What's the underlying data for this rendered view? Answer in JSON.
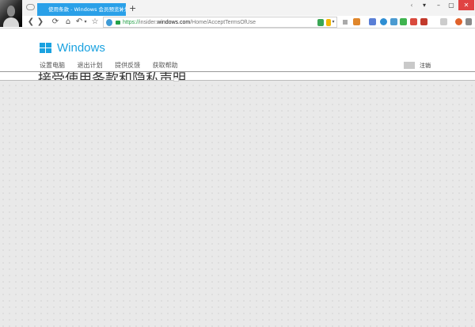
{
  "browser": {
    "tab_title": "使用条款 - Windows 会员预览计划",
    "tab_close": "×",
    "new_tab": "+",
    "window_controls": [
      "‹",
      "▾",
      "–",
      "▢",
      "✕"
    ],
    "nav": {
      "back": "❮",
      "forward": "❯",
      "reload": "⟳",
      "home": "⌂",
      "undo": "↶",
      "undo_menu": "▾",
      "favorite": "☆"
    },
    "url": {
      "scheme": "https://",
      "host_pre": "insider.",
      "host": "windows.com",
      "path": "/Home/AcceptTermsOfUse"
    },
    "url_menu": "▾"
  },
  "page": {
    "brand": "Windows",
    "nav_items": [
      "设置电脑",
      "退出计划",
      "提供反馈",
      "获取帮助"
    ],
    "signout": "注销",
    "heading": "接受使用条款和隐私声明"
  },
  "colors": {
    "accent": "#1aa2e0",
    "tab": "#2aa0e8",
    "secure": "#24a148",
    "close_button": "#e04343"
  }
}
